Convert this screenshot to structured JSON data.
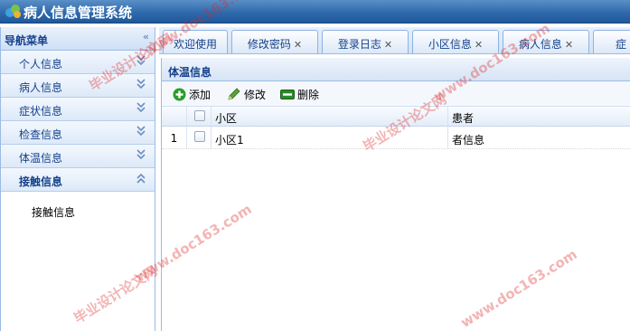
{
  "app": {
    "title": "病人信息管理系统"
  },
  "nav": {
    "header": "导航菜单",
    "collapse_glyph": "«",
    "items": [
      {
        "label": "个人信息",
        "expanded": false
      },
      {
        "label": "病人信息",
        "expanded": false
      },
      {
        "label": "症状信息",
        "expanded": false
      },
      {
        "label": "检查信息",
        "expanded": false
      },
      {
        "label": "体温信息",
        "expanded": false
      },
      {
        "label": "接触信息",
        "expanded": true
      }
    ],
    "sub_item": "接触信息"
  },
  "tabs": [
    {
      "label": "欢迎使用",
      "closable": false
    },
    {
      "label": "修改密码",
      "closable": true
    },
    {
      "label": "登录日志",
      "closable": true
    },
    {
      "label": "小区信息",
      "closable": true
    },
    {
      "label": "病人信息",
      "closable": true
    },
    {
      "label": "症",
      "closable": false
    }
  ],
  "close_glyph": "✕",
  "panel": {
    "title": "体温信息",
    "toolbar": {
      "add": "添加",
      "edit": "修改",
      "delete": "删除"
    },
    "columns": [
      "小区",
      "患者"
    ],
    "rows": [
      {
        "num": "1",
        "community": "小区1",
        "patient": "者信息"
      }
    ]
  },
  "watermarks": [
    "毕业设计论文网",
    "www.doc163.com"
  ],
  "colors": {
    "header": "#2f6aad",
    "accent": "#15428b",
    "add_icon": "#2a9d2a",
    "edit_icon": "#3d8c2a",
    "delete_icon": "#2b8a2b"
  }
}
